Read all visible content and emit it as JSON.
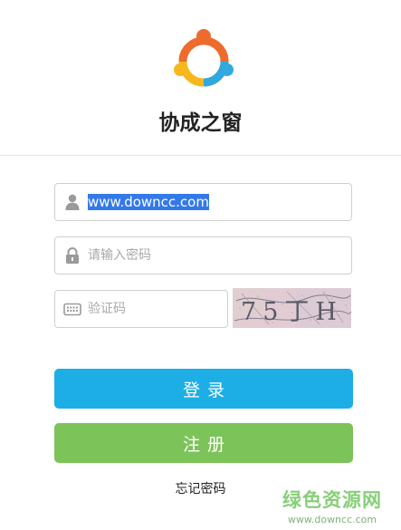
{
  "app": {
    "title": "协成之窗"
  },
  "form": {
    "username_value": "www.downcc.com",
    "password_placeholder": "请输入密码",
    "captcha_placeholder": "验证码",
    "captcha_image_text": "75丁H"
  },
  "buttons": {
    "login_label": "登录",
    "register_label": "注册"
  },
  "links": {
    "forgot_password": "忘记密码"
  },
  "watermark": {
    "text": "绿色资源网",
    "url": "www.downcc.com"
  },
  "colors": {
    "login_button": "#1daee5",
    "register_button": "#7cc35a",
    "logo_orange": "#ec6b2d",
    "logo_blue": "#30a8e0",
    "logo_yellow": "#f6b81d",
    "watermark_green": "#5fbf4a"
  },
  "icons": {
    "username": "user-icon",
    "password": "lock-icon",
    "captcha": "keyboard-icon",
    "logo": "people-circle-logo"
  }
}
